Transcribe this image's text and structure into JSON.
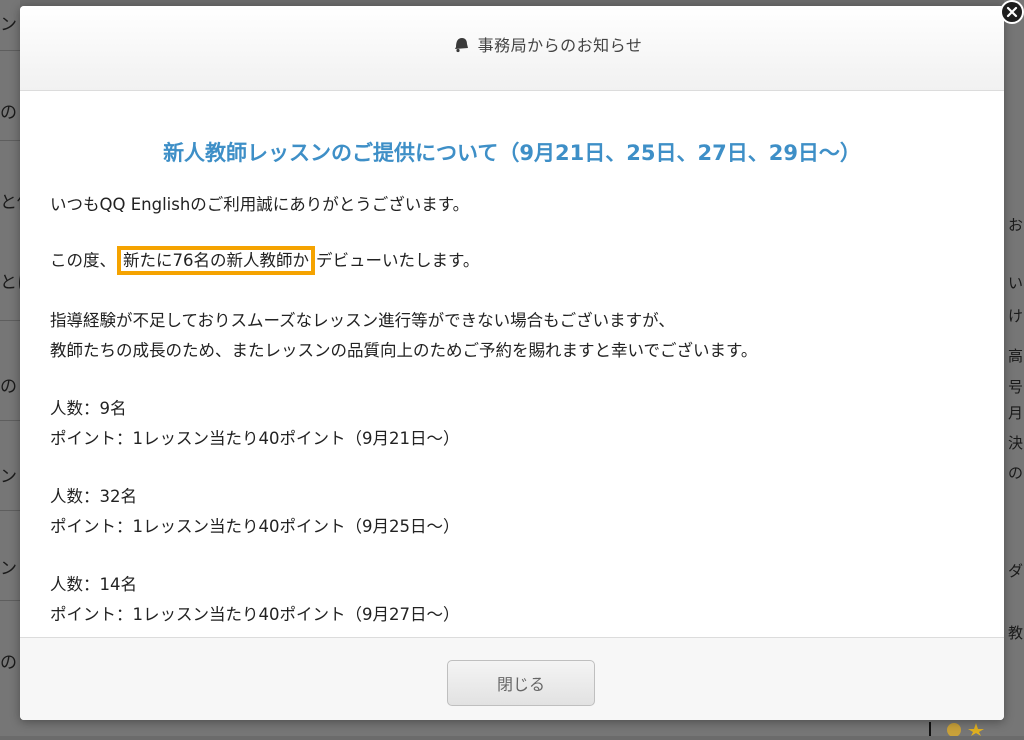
{
  "header": {
    "title": "事務局からのお知らせ",
    "icon": "bell-icon"
  },
  "notice": {
    "title": "新人教師レッスンのご提供について（9月21日、25日、27日、29日〜）",
    "greeting": "いつもQQ Englishのご利用誠にありがとうございます。",
    "announce_prefix": "この度、",
    "announce_highlight": "新たに76名の新人教師か",
    "announce_suffix": "デビューいたします。",
    "note_line1": "指導経験が不足しておりスムーズなレッスン進行等ができない場合もございますが、",
    "note_line2": "教師たちの成長のため、またレッスンの品質向上のためご予約を賜れますと幸いでございます。",
    "groups": [
      {
        "count": "人数：9名",
        "points": "ポイント：1レッスン当たり40ポイント（9月21日〜）"
      },
      {
        "count": "人数：32名",
        "points": "ポイント：1レッスン当たり40ポイント（9月25日〜）"
      },
      {
        "count": "人数：14名",
        "points": "ポイント：1レッスン当たり40ポイント（9月27日〜）"
      }
    ]
  },
  "footer": {
    "close_label": "閉じる"
  },
  "colors": {
    "title": "#3e8fc7",
    "highlight_border": "#f5a300"
  },
  "background": {
    "left_fragments": [
      "ンド",
      "のこ",
      "と伴",
      "とに",
      "のこ",
      "ント",
      "ンド",
      "のこ"
    ],
    "right_fragments": [
      "お",
      "い",
      "け",
      "高",
      "号",
      "月",
      "決",
      "の",
      "ダ",
      "教"
    ]
  }
}
